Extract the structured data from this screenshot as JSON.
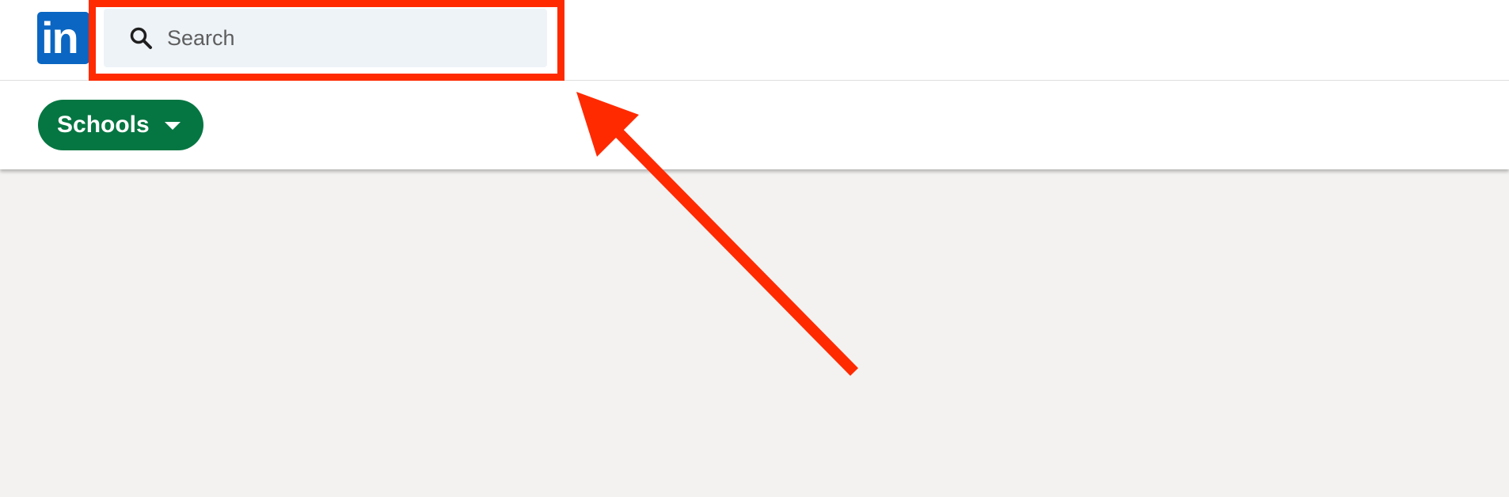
{
  "header": {
    "logo_text": "in",
    "search": {
      "placeholder": "Search",
      "icon": "search-icon"
    }
  },
  "filters": {
    "schools_label": "Schools",
    "schools_icon": "caret-down-icon",
    "active_color": "#057642"
  },
  "annotation": {
    "highlight_color": "#ff2a00",
    "arrow_color": "#ff2a00"
  },
  "colors": {
    "brand": "#0a66c2",
    "page_background": "#f3f2f0",
    "search_background": "#eef3f8"
  }
}
